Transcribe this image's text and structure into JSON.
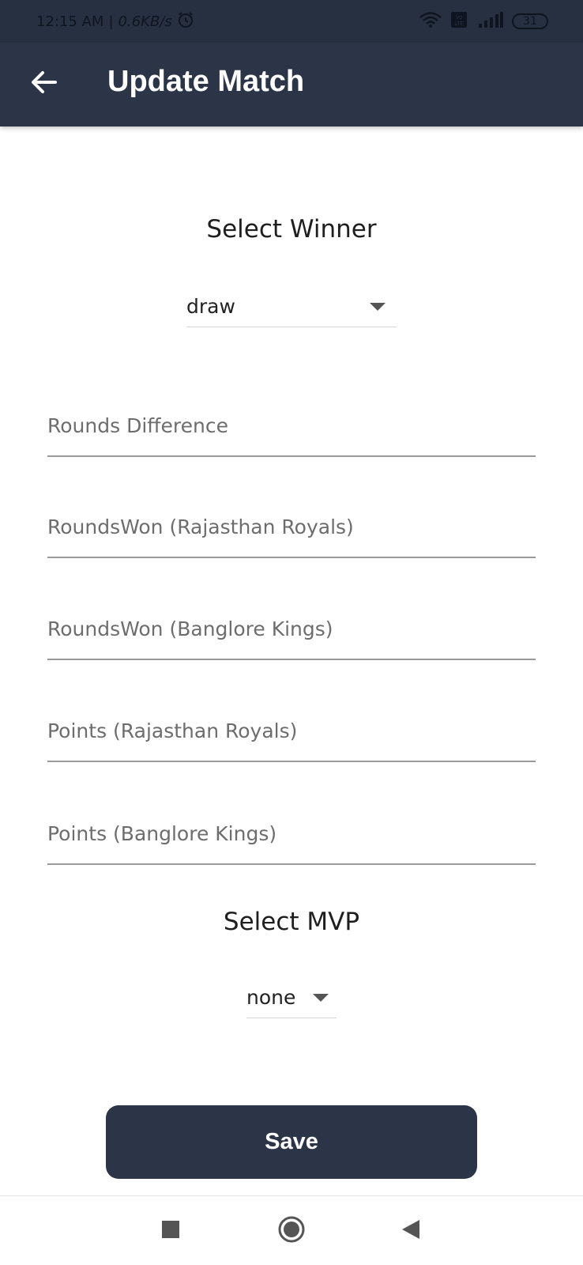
{
  "status_bar": {
    "time": "12:15 AM",
    "separator": "|",
    "speed": "0.6KB/s",
    "battery": "31",
    "icons": [
      "alarm-icon",
      "wifi-icon",
      "volte-icon",
      "signal-icon",
      "battery-icon"
    ]
  },
  "app_bar": {
    "title": "Update Match",
    "back_icon": "arrow-left-icon"
  },
  "winner": {
    "heading": "Select Winner",
    "selected": "draw"
  },
  "fields": {
    "rounds_difference": "Rounds Difference",
    "rounds_won_team1": "RoundsWon (Rajasthan Royals)",
    "rounds_won_team2": "RoundsWon (Banglore Kings)",
    "points_team1": "Points (Rajasthan Royals)",
    "points_team2": "Points (Banglore Kings)"
  },
  "mvp": {
    "heading": "Select MVP",
    "selected": "none"
  },
  "save_label": "Save",
  "nav": {
    "icons": [
      "recents-square-icon",
      "home-circle-icon",
      "back-triangle-icon"
    ]
  },
  "colors": {
    "primary": "#2b3547",
    "status_bar": "#263040",
    "underline": "#9a9a9a"
  }
}
